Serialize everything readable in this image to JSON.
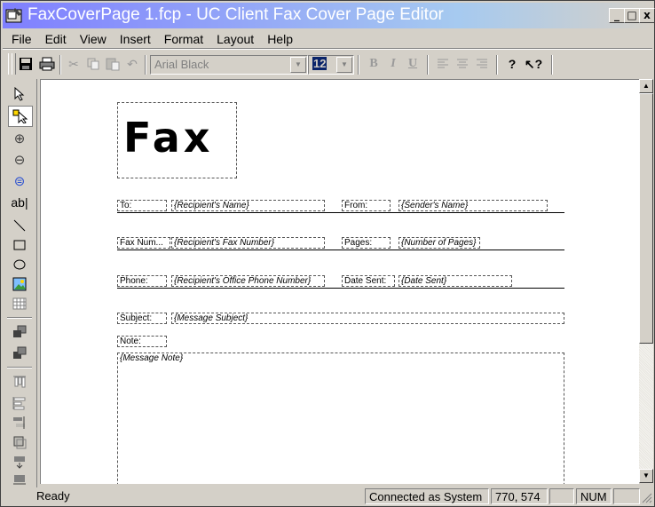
{
  "window": {
    "title": "FaxCoverPage 1.fcp - UC Client Fax Cover Page Editor",
    "minimize": "_",
    "maximize": "□",
    "close": "x"
  },
  "menu": [
    "File",
    "Edit",
    "View",
    "Insert",
    "Format",
    "Layout",
    "Help"
  ],
  "toolbar": {
    "font_name": "Arial Black",
    "font_size": "12",
    "bold": "B",
    "italic": "I",
    "underline": "U"
  },
  "document": {
    "heading": "Fax",
    "to_label": "To:",
    "to_value": "{Recipient's Name}",
    "from_label": "From:",
    "from_value": "{Sender's Name}",
    "faxnum_label": "Fax Num...",
    "faxnum_value": "{Recipient's Fax Number}",
    "pages_label": "Pages:",
    "pages_value": "{Number of Pages}",
    "phone_label": "Phone:",
    "phone_value": "{Recipient's Office Phone Number}",
    "datesent_label": "Date Sent:",
    "datesent_value": "{Date Sent}",
    "subject_label": "Subject:",
    "subject_value": "{Message Subject}",
    "note_label": "Note:",
    "note_value": "{Message Note}"
  },
  "status": {
    "ready": "Ready",
    "connection": "Connected as System",
    "coords": "770, 574",
    "num": "NUM"
  }
}
